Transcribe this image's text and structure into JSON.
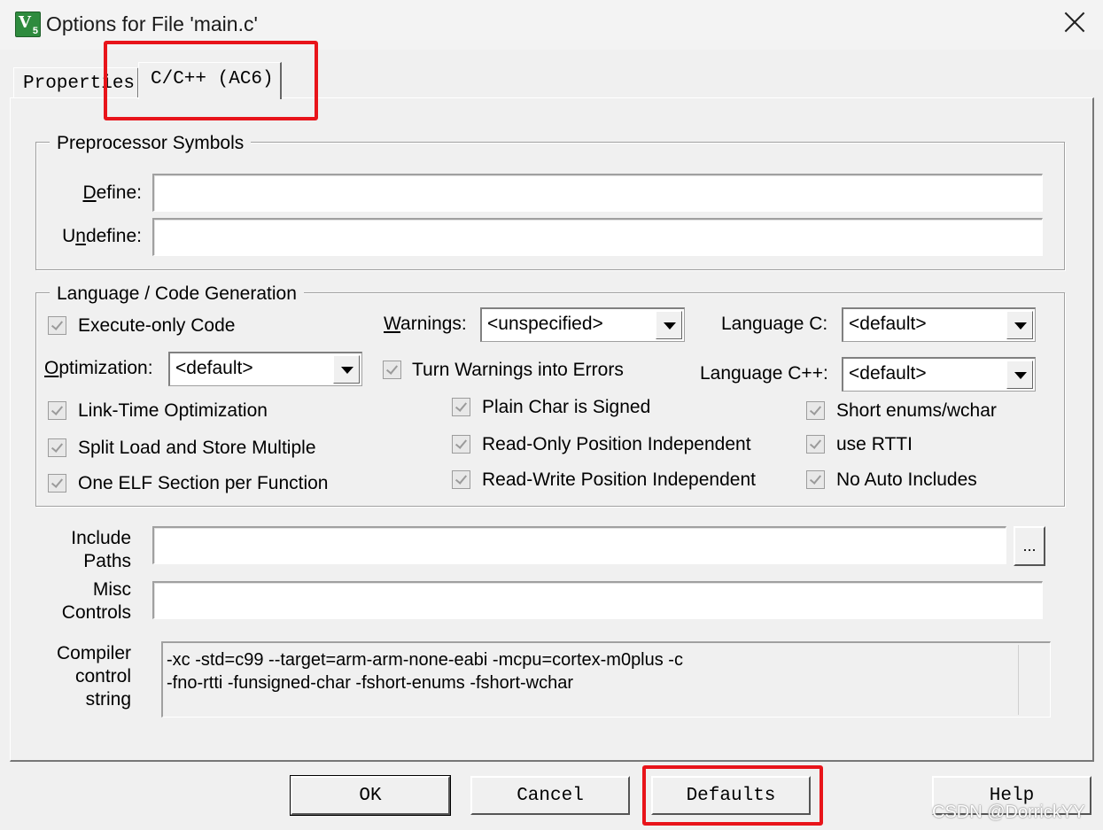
{
  "window": {
    "title": "Options for File 'main.c'"
  },
  "tabs": [
    {
      "label": "Properties"
    },
    {
      "label": "C/C++ (AC6)"
    }
  ],
  "preprocessor": {
    "group_title": "Preprocessor Symbols",
    "define_label": "Define:",
    "define_value": "",
    "undefine_label": "Undefine:",
    "undefine_value": ""
  },
  "language": {
    "group_title": "Language / Code Generation",
    "execute_only": "Execute-only Code",
    "warnings_label": "Warnings:",
    "warnings_value": "<unspecified>",
    "language_c_label": "Language C:",
    "language_c_value": "<default>",
    "optimization_label": "Optimization:",
    "optimization_value": "<default>",
    "turn_warnings": "Turn Warnings into Errors",
    "language_cpp_label": "Language C++:",
    "language_cpp_value": "<default>",
    "lto": "Link-Time Optimization",
    "plain_char": "Plain Char is Signed",
    "short_enums": "Short enums/wchar",
    "split_load": "Split Load and Store Multiple",
    "ropi": "Read-Only Position Independent",
    "rtti": "use RTTI",
    "one_elf": "One ELF Section per Function",
    "rwpi": "Read-Write Position Independent",
    "no_auto": "No Auto Includes"
  },
  "include": {
    "label_1": "Include",
    "label_2": "Paths",
    "value": "",
    "browse": "..."
  },
  "misc": {
    "label_1": "Misc",
    "label_2": "Controls",
    "value": ""
  },
  "compiler": {
    "label_1": "Compiler",
    "label_2": "control",
    "label_3": "string",
    "line_1": "-xc -std=c99 --target=arm-arm-none-eabi -mcpu=cortex-m0plus -c",
    "line_2": "-fno-rtti -funsigned-char -fshort-enums -fshort-wchar"
  },
  "buttons": {
    "ok": "OK",
    "cancel": "Cancel",
    "defaults": "Defaults",
    "help": "Help"
  },
  "watermark": "CSDN @DorrickYY",
  "colors": {
    "highlight": "#e8141a",
    "background": "#f0f0f0"
  }
}
